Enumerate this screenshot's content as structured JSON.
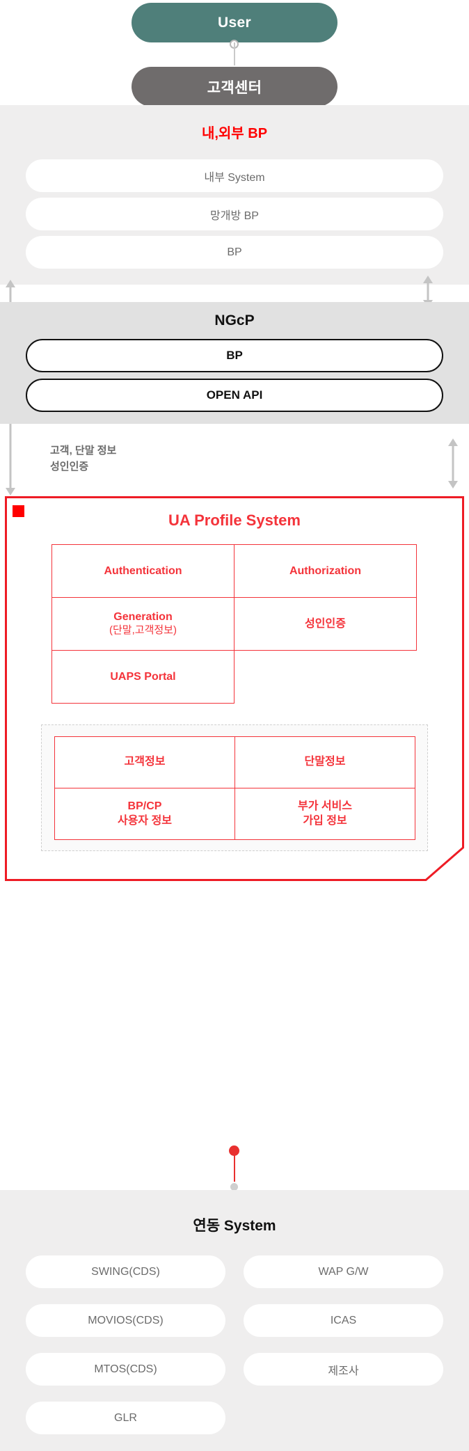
{
  "top": {
    "user_label": "User",
    "call_center_label": "고객센터"
  },
  "bp_zone": {
    "title": "내,외부 BP",
    "items": [
      {
        "label": "내부 System"
      },
      {
        "label": "망개방 BP"
      },
      {
        "label": "BP"
      }
    ]
  },
  "ngcp_zone": {
    "title": "NGcP",
    "items": [
      {
        "label": "BP"
      },
      {
        "label": "OPEN API"
      }
    ]
  },
  "mid_labels": {
    "line1": "고객, 단말 정보",
    "line2": "성인인증"
  },
  "ua_profile": {
    "title": "UA Profile System",
    "functions": [
      {
        "label": "Authentication",
        "sub": ""
      },
      {
        "label": "Authorization",
        "sub": ""
      },
      {
        "label": "Generation",
        "sub": "(단말,고객정보)"
      },
      {
        "label": "성인인증",
        "sub": ""
      },
      {
        "label": "UAPS Portal",
        "sub": ""
      }
    ],
    "data_stores": [
      {
        "label": "고객정보"
      },
      {
        "label": "단말정보"
      },
      {
        "label": "BP/CP\n사용자 정보"
      },
      {
        "label": "부가 서비스\n가입 정보"
      }
    ]
  },
  "link_zone": {
    "title": "연동 System",
    "left_items": [
      {
        "label": "SWING(CDS)"
      },
      {
        "label": "MOVIOS(CDS)"
      },
      {
        "label": "MTOS(CDS)"
      },
      {
        "label": "GLR"
      }
    ],
    "right_items": [
      {
        "label": "WAP G/W"
      },
      {
        "label": "ICAS"
      },
      {
        "label": "제조사"
      }
    ]
  },
  "colors": {
    "user_bg": "#4f7f7a",
    "call_center_bg": "#6f6c6c",
    "accent_red": "#ff0000",
    "box_red": "#f4333a",
    "zone_light": "#efeeee",
    "zone_dark": "#e1e1e1",
    "text_gray": "#6b6b6b"
  }
}
